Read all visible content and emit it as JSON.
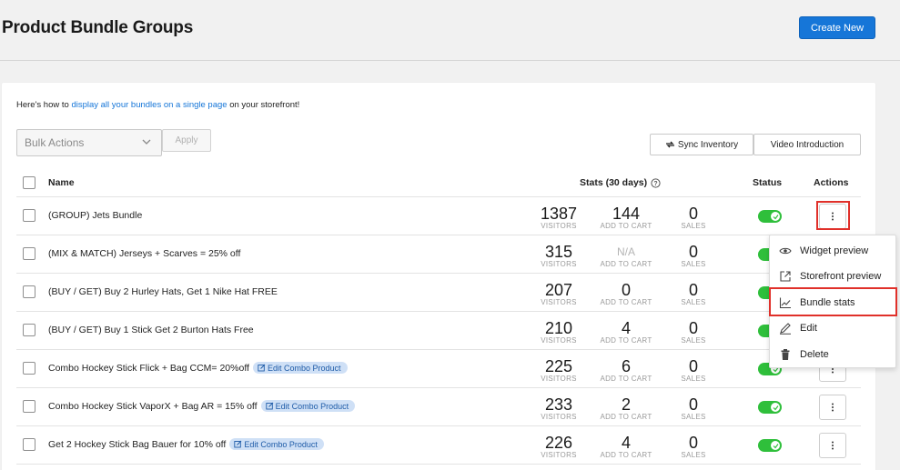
{
  "header": {
    "title": "Product Bundle Groups",
    "create_label": "Create New"
  },
  "intro": {
    "before": "Here's how to ",
    "link": "display all your bundles on a single page",
    "after": " on your storefront!"
  },
  "toolbar": {
    "bulk_placeholder": "Bulk Actions",
    "apply_label": "Apply",
    "sync_label": "Sync Inventory",
    "video_label": "Video Introduction"
  },
  "table": {
    "headers": {
      "name": "Name",
      "stats": "Stats (30 days)",
      "status": "Status",
      "actions": "Actions"
    },
    "labels": {
      "visitors": "VISITORS",
      "add_to_cart": "ADD TO CART",
      "sales": "SALES"
    },
    "rows": [
      {
        "name": "(GROUP) Jets Bundle",
        "visitors": "1387",
        "add_to_cart": "144",
        "sales": "0",
        "combo": "",
        "status": "on"
      },
      {
        "name": "(MIX & MATCH) Jerseys + Scarves = 25% off",
        "visitors": "315",
        "add_to_cart": "N/A",
        "sales": "0",
        "combo": "",
        "status": "on"
      },
      {
        "name": "(BUY / GET) Buy 2 Hurley Hats, Get 1 Nike Hat FREE",
        "visitors": "207",
        "add_to_cart": "0",
        "sales": "0",
        "combo": "",
        "status": "on"
      },
      {
        "name": "(BUY / GET) Buy 1 Stick Get 2 Burton Hats Free",
        "visitors": "210",
        "add_to_cart": "4",
        "sales": "0",
        "combo": "",
        "status": "on"
      },
      {
        "name": "Combo Hockey Stick Flick + Bag CCM= 20%off",
        "visitors": "225",
        "add_to_cart": "6",
        "sales": "0",
        "combo": "Edit Combo Product",
        "status": "on"
      },
      {
        "name": "Combo Hockey Stick VaporX + Bag AR = 15% off",
        "visitors": "233",
        "add_to_cart": "2",
        "sales": "0",
        "combo": "Edit Combo Product",
        "status": "on"
      },
      {
        "name": "Get 2 Hockey Stick Bag Bauer for 10% off",
        "visitors": "226",
        "add_to_cart": "4",
        "sales": "0",
        "combo": "Edit Combo Product",
        "status": "on"
      }
    ]
  },
  "actions_menu": {
    "items": [
      {
        "label": "Widget preview",
        "icon": "eye-icon"
      },
      {
        "label": "Storefront preview",
        "icon": "external-link-icon"
      },
      {
        "label": "Bundle stats",
        "icon": "chart-line-icon"
      },
      {
        "label": "Edit",
        "icon": "pencil-icon"
      },
      {
        "label": "Delete",
        "icon": "trash-icon"
      }
    ]
  },
  "colors": {
    "accent": "#1676d8",
    "toggle_on": "#2fbf3b",
    "highlight": "#e0302a",
    "badge_bg": "#cfe0f6"
  }
}
